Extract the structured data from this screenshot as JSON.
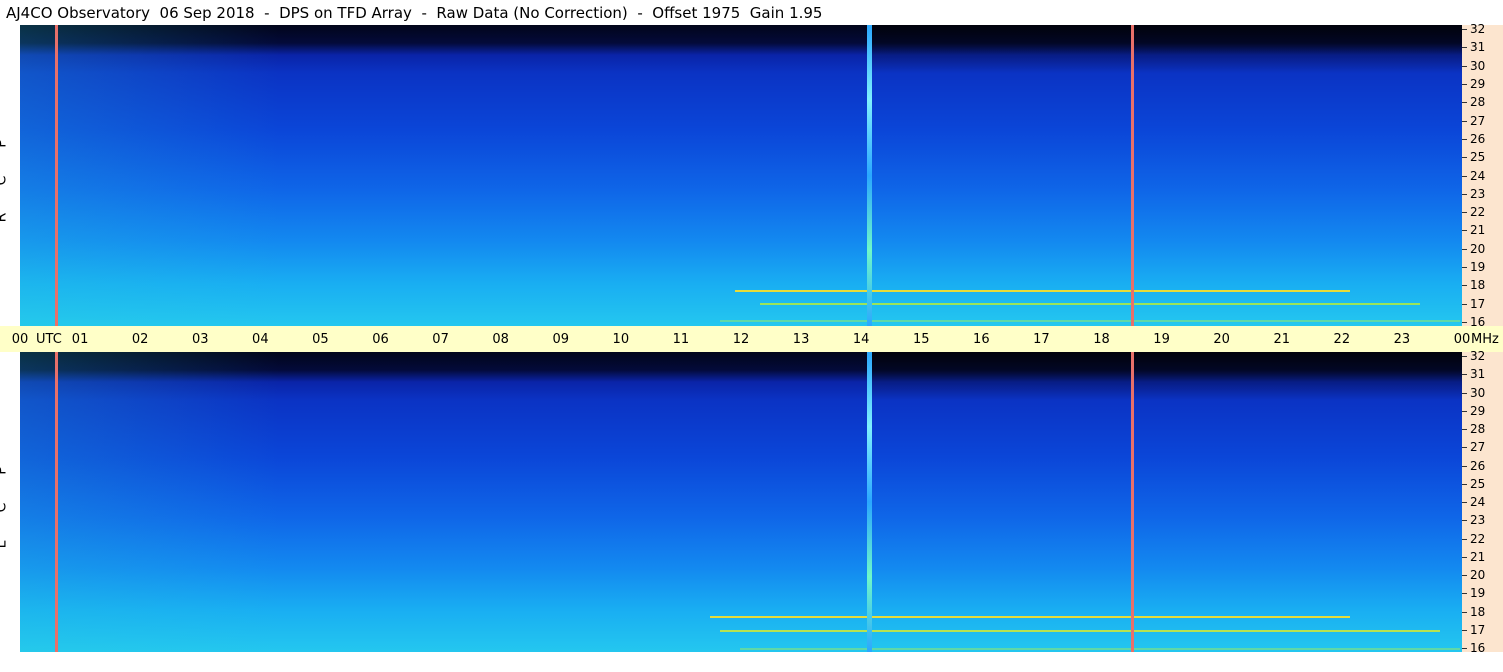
{
  "title": "AJ4CO Observatory  06 Sep 2018  -  DPS on TFD Array  -  Raw Data (No Correction)  -  Offset 1975  Gain 1.95",
  "time_axis": {
    "start_label": "00",
    "utc_label": "UTC",
    "labels": [
      "01",
      "02",
      "03",
      "04",
      "05",
      "06",
      "07",
      "08",
      "09",
      "10",
      "11",
      "12",
      "13",
      "14",
      "15",
      "16",
      "17",
      "18",
      "19",
      "20",
      "21",
      "22",
      "23"
    ],
    "end_label": "00",
    "unit_label": "MHz"
  },
  "panels": [
    {
      "name": "top",
      "polarization": [
        "R",
        "C",
        "P"
      ]
    },
    {
      "name": "bottom",
      "polarization": [
        "L",
        "C",
        "P"
      ]
    }
  ],
  "freq_labels": [
    "32",
    "31",
    "30",
    "29",
    "28",
    "27",
    "26",
    "25",
    "24",
    "23",
    "22",
    "21",
    "20",
    "19",
    "18",
    "17",
    "16"
  ],
  "chart_data": {
    "type": "heatmap",
    "title": "AJ4CO Observatory  06 Sep 2018  -  DPS on TFD Array  -  Raw Data (No Correction)  -  Offset 1975  Gain 1.95",
    "x_axis": {
      "unit": "UTC",
      "range": [
        0,
        24
      ],
      "ticks": [
        "00",
        "01",
        "02",
        "03",
        "04",
        "05",
        "06",
        "07",
        "08",
        "09",
        "10",
        "11",
        "12",
        "13",
        "14",
        "15",
        "16",
        "17",
        "18",
        "19",
        "20",
        "21",
        "22",
        "23",
        "00"
      ]
    },
    "y_axis": {
      "unit": "MHz",
      "range": [
        16,
        32
      ],
      "ticks": [
        32,
        31,
        30,
        29,
        28,
        27,
        26,
        25,
        24,
        23,
        22,
        21,
        20,
        19,
        18,
        17,
        16
      ]
    },
    "series": [
      {
        "name": "RCP"
      },
      {
        "name": "LCP"
      }
    ],
    "colors": {
      "low": "#02051a",
      "mid": "#0b46d8",
      "high": "#24c7ef",
      "axis_band": "#ffffc8",
      "freq_band": "#fce5cf",
      "marker_line": "#e8706a"
    }
  }
}
